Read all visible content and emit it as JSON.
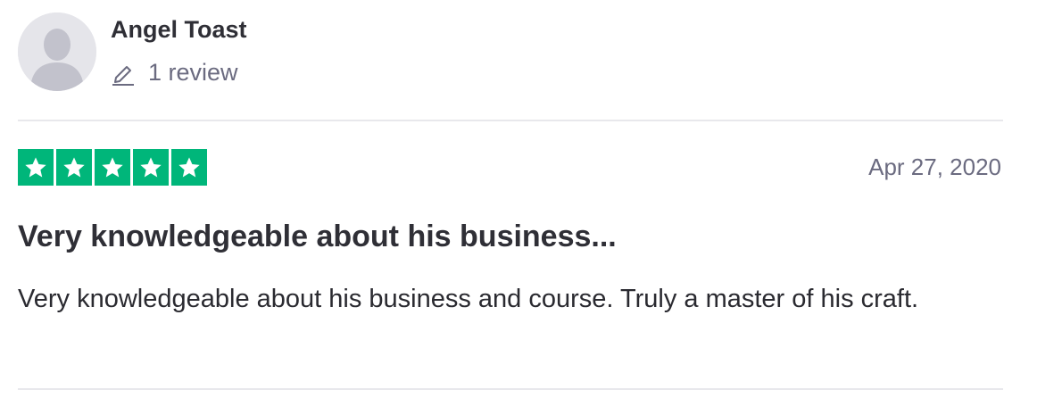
{
  "reviewer": {
    "name": "Angel Toast",
    "review_count": "1 review",
    "avatar_icon": "user-silhouette-icon",
    "count_icon": "pencil-icon"
  },
  "review": {
    "rating": 5,
    "rating_max": 5,
    "star_color": "#00b67a",
    "date": "Apr 27, 2020",
    "title": "Very knowledgeable about his business...",
    "body": "Very knowledgeable about his business and course. Truly a master of his craft."
  }
}
